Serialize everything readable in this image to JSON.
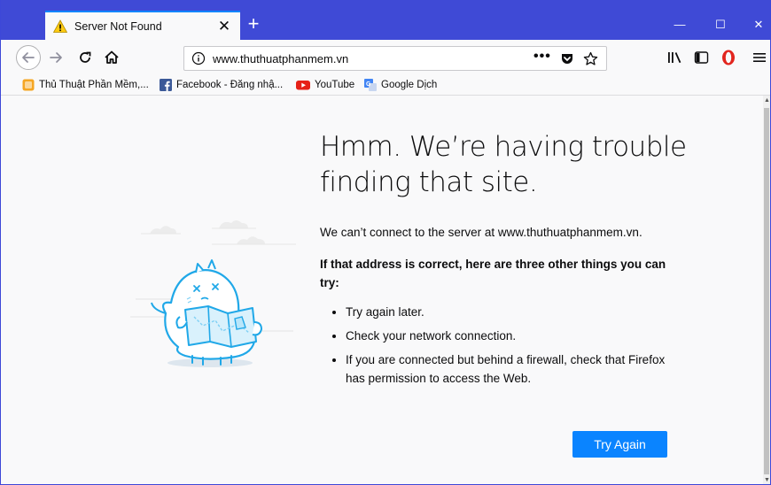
{
  "tab": {
    "title": "Server Not Found",
    "close_glyph": "✕",
    "icon": "warning-icon"
  },
  "new_tab_glyph": "+",
  "window_controls": {
    "minimize": "—",
    "maximize": "☐",
    "close": "✕"
  },
  "urlbar": {
    "url": "www.thuthuatphanmem.vn",
    "page_actions_glyph": "•••"
  },
  "bookmarks": [
    {
      "label": "Thủ Thuật Phần Mềm,...",
      "icon": "bookmark-site-icon",
      "color": "#f5a623"
    },
    {
      "label": "Facebook - Đăng nhậ...",
      "icon": "facebook-icon",
      "color": "#3b5998"
    },
    {
      "label": "YouTube",
      "icon": "youtube-icon",
      "color": "#e62117"
    },
    {
      "label": "Google Dịch",
      "icon": "google-translate-icon",
      "color": "#4285f4"
    }
  ],
  "error": {
    "title": "Hmm. We’re having trouble finding that site.",
    "description": "We can’t connect to the server at www.thuthuatphanmem.vn.",
    "subhead": "If that address is correct, here are three other things you can try:",
    "suggestions": [
      "Try again later.",
      "Check your network connection.",
      "If you are connected but behind a firewall, check that Firefox has permission to access the Web."
    ],
    "button_label": "Try Again"
  },
  "colors": {
    "titlebar": "#3f4ad6",
    "accent": "#0a84ff",
    "opera_red": "#e2251e"
  }
}
